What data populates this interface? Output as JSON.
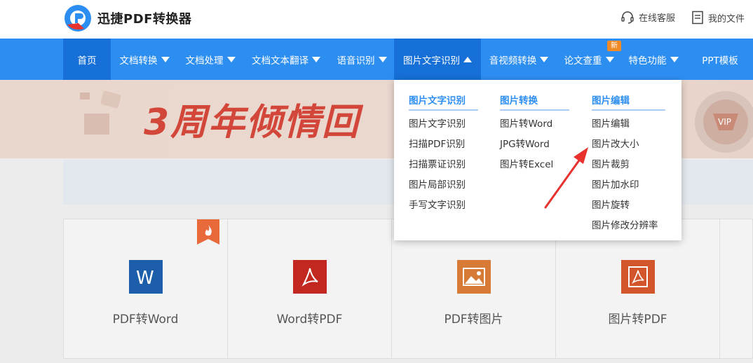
{
  "header": {
    "brand": "迅捷PDF转换器",
    "service_label": "在线客服",
    "files_label": "我的文件"
  },
  "nav": {
    "items": [
      {
        "label": "首页"
      },
      {
        "label": "文档转换"
      },
      {
        "label": "文档处理"
      },
      {
        "label": "文档文本翻译"
      },
      {
        "label": "语音识别"
      },
      {
        "label": "图片文字识别"
      },
      {
        "label": "音视频转换"
      },
      {
        "label": "论文查重"
      },
      {
        "label": "特色功能"
      },
      {
        "label": "PPT模板"
      }
    ],
    "new_badge": "新",
    "active_index": 5
  },
  "banner": {
    "title": "3周年倾情回"
  },
  "dropdown": {
    "columns": [
      {
        "heading": "图片文字识别",
        "links": [
          "图片文字识别",
          "扫描PDF识别",
          "扫描票证识别",
          "图片局部识别",
          "手写文字识别"
        ]
      },
      {
        "heading": "图片转换",
        "links": [
          "图片转Word",
          "JPG转Word",
          "图片转Excel"
        ]
      },
      {
        "heading": "图片编辑",
        "links": [
          "图片编辑",
          "图片改大小",
          "图片裁剪",
          "图片加水印",
          "图片旋转",
          "图片修改分辨率"
        ]
      }
    ]
  },
  "cards": [
    {
      "label": "PDF转Word",
      "icon": "word-icon"
    },
    {
      "label": "Word转PDF",
      "icon": "pdf-icon"
    },
    {
      "label": "PDF转图片",
      "icon": "image-icon"
    },
    {
      "label": "图片转PDF",
      "icon": "image-pdf-icon"
    }
  ],
  "colors": {
    "nav_bg": "#2d8ef2",
    "nav_active": "#1670d8",
    "accent": "#2d8ef2",
    "annotation_arrow": "#e8322e"
  }
}
